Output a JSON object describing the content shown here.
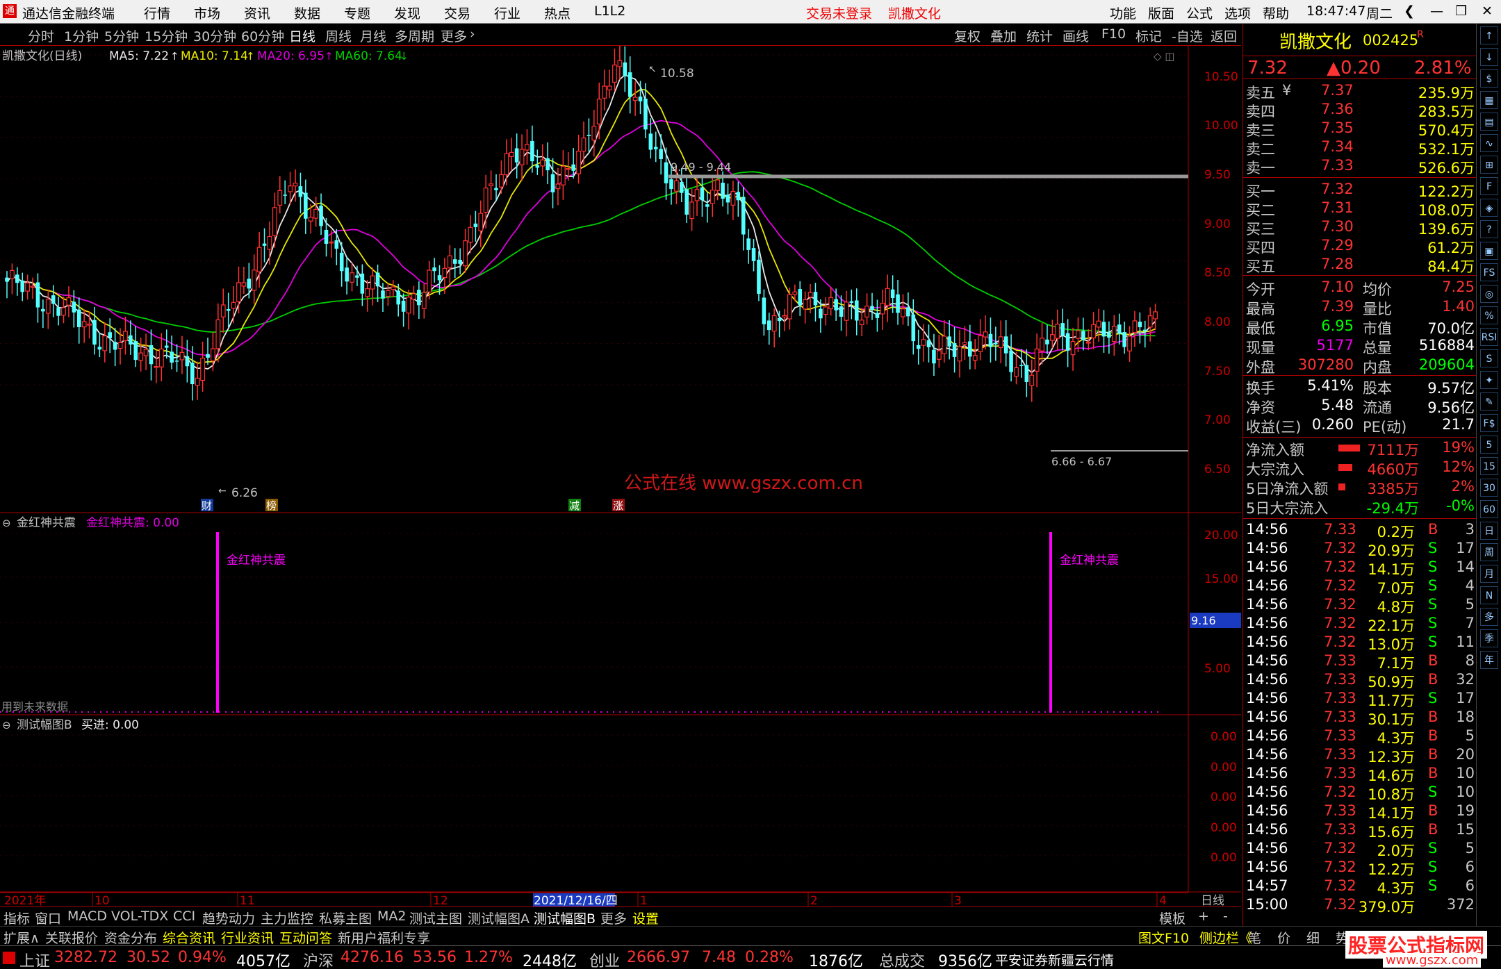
{
  "menubar": {
    "app_title": "通达信金融终端",
    "menus": [
      "行情",
      "市场",
      "资讯",
      "数据",
      "专题",
      "发现",
      "交易",
      "行业",
      "热点",
      "L1L2"
    ],
    "trade_status": "交易未登录",
    "stock_name": "凯撒文化",
    "right_menus": [
      "功能",
      "版面",
      "公式",
      "选项",
      "帮助"
    ],
    "time": "18:47:47",
    "weekday": "周二"
  },
  "periodbar": {
    "periods": [
      "分时",
      "1分钟",
      "5分钟",
      "15分钟",
      "30分钟",
      "60分钟",
      "日线",
      "周线",
      "月线",
      "多周期",
      "更多"
    ],
    "active": "日线",
    "tools": [
      "复权",
      "叠加",
      "统计",
      "画线",
      "F10",
      "标记",
      "-自选",
      "返回"
    ]
  },
  "main_chart": {
    "title": "凯撒文化(日线)",
    "ma5_label": "MA5: 7.22",
    "ma10_label": "MA10: 7.14",
    "ma20_label": "MA20: 6.95",
    "ma60_label": "MA60: 7.64",
    "y_ticks": [
      "10.50",
      "10.00",
      "9.50",
      "9.00",
      "8.50",
      "8.00",
      "7.50",
      "7.00",
      "6.50"
    ],
    "high_label": "10.58",
    "low_label": "6.26",
    "range1": "9.49 - 9.44",
    "range2": "6.66 - 6.67",
    "watermark": "公式在线 www.gszx.com.cn",
    "markers": [
      "财",
      "榜",
      "减",
      "涨"
    ]
  },
  "indicator1": {
    "name": "金红神共震",
    "value_label": "金红神共震: 0.00",
    "signal_label": "金红神共震",
    "y_ticks": [
      "20.00",
      "15.00",
      "5.00"
    ],
    "current": "9.16",
    "future_note": "用到未来数据"
  },
  "indicator2": {
    "name": "测试幅图B",
    "value_label": "买进: 0.00",
    "y_ticks": [
      "0.00",
      "0.00",
      "0.00",
      "0.00",
      "0.00"
    ]
  },
  "xaxis": {
    "labels": [
      "2021年",
      "10",
      "11",
      "12",
      "2021/12/16/四",
      "1",
      "2",
      "3",
      "4"
    ],
    "period": "日线"
  },
  "quote": {
    "name": "凯撒文化",
    "code": "002425",
    "flag": "R",
    "price": "7.32",
    "change": "▲0.20",
    "pct": "2.81%",
    "asks": [
      {
        "l": "卖五",
        "f": "¥",
        "p": "7.37",
        "v": "235.9万"
      },
      {
        "l": "卖四",
        "p": "7.36",
        "v": "283.5万"
      },
      {
        "l": "卖三",
        "p": "7.35",
        "v": "570.4万"
      },
      {
        "l": "卖二",
        "p": "7.34",
        "v": "532.1万"
      },
      {
        "l": "卖一",
        "p": "7.33",
        "v": "526.6万"
      }
    ],
    "bids": [
      {
        "l": "买一",
        "p": "7.32",
        "v": "122.2万"
      },
      {
        "l": "买二",
        "p": "7.31",
        "v": "108.0万"
      },
      {
        "l": "买三",
        "p": "7.30",
        "v": "139.6万"
      },
      {
        "l": "买四",
        "p": "7.29",
        "v": "61.2万"
      },
      {
        "l": "买五",
        "p": "7.28",
        "v": "84.4万"
      }
    ],
    "stats": [
      [
        "今开",
        "7.10",
        "均价",
        "7.25"
      ],
      [
        "最高",
        "7.39",
        "量比",
        "1.40"
      ],
      [
        "最低",
        "6.95",
        "市值",
        "70.0亿"
      ],
      [
        "现量",
        "5177",
        "总量",
        "516884"
      ],
      [
        "外盘",
        "307280",
        "内盘",
        "209604"
      ]
    ],
    "stats2": [
      [
        "换手",
        "5.41%",
        "股本",
        "9.57亿"
      ],
      [
        "净资",
        "5.48",
        "流通",
        "9.56亿"
      ],
      [
        "收益(三)",
        "0.260",
        "PE(动)",
        "21.7"
      ]
    ],
    "flows": [
      [
        "净流入额",
        "7111万",
        "19%"
      ],
      [
        "大宗流入",
        "4660万",
        "12%"
      ],
      [
        "5日净流入额",
        "3385万",
        "2%"
      ],
      [
        "5日大宗流入",
        "-29.4万",
        "-0%"
      ]
    ],
    "ticks": [
      [
        "14:56",
        "7.33",
        "0.2万",
        "B",
        "3"
      ],
      [
        "14:56",
        "7.32",
        "20.9万",
        "S",
        "17"
      ],
      [
        "14:56",
        "7.32",
        "14.1万",
        "S",
        "14"
      ],
      [
        "14:56",
        "7.32",
        "7.0万",
        "S",
        "4"
      ],
      [
        "14:56",
        "7.32",
        "4.8万",
        "S",
        "5"
      ],
      [
        "14:56",
        "7.32",
        "22.1万",
        "S",
        "7"
      ],
      [
        "14:56",
        "7.32",
        "13.0万",
        "S",
        "11"
      ],
      [
        "14:56",
        "7.33",
        "7.1万",
        "B",
        "8"
      ],
      [
        "14:56",
        "7.33",
        "50.9万",
        "B",
        "32"
      ],
      [
        "14:56",
        "7.33",
        "11.7万",
        "S",
        "17"
      ],
      [
        "14:56",
        "7.33",
        "30.1万",
        "B",
        "18"
      ],
      [
        "14:56",
        "7.33",
        "4.3万",
        "B",
        "5"
      ],
      [
        "14:56",
        "7.33",
        "12.3万",
        "B",
        "20"
      ],
      [
        "14:56",
        "7.33",
        "14.6万",
        "B",
        "10"
      ],
      [
        "14:56",
        "7.32",
        "10.8万",
        "S",
        "10"
      ],
      [
        "14:56",
        "7.33",
        "14.1万",
        "B",
        "19"
      ],
      [
        "14:56",
        "7.33",
        "15.6万",
        "B",
        "15"
      ],
      [
        "14:56",
        "7.32",
        "2.0万",
        "S",
        "5"
      ],
      [
        "14:56",
        "7.32",
        "12.2万",
        "S",
        "6"
      ],
      [
        "14:57",
        "7.32",
        "4.3万",
        "S",
        "6"
      ],
      [
        "15:00",
        "7.32",
        "379.0万",
        "",
        "372"
      ]
    ]
  },
  "iconbar": [
    "↑",
    "↓",
    "$",
    "▦",
    "▤",
    "∿",
    "⊞",
    "F",
    "◈",
    "?",
    "▣",
    "FS",
    "◎",
    "%",
    "RSI",
    "S",
    "✦",
    "✎",
    "F$",
    "5",
    "15",
    "30",
    "60",
    "日",
    "周",
    "月",
    "N",
    "多",
    "季",
    "年"
  ],
  "bottomtabs": [
    "指标",
    "窗口",
    "MACD",
    "VOL-TDX",
    "CCI",
    "趋势动力",
    "主力监控",
    "私募主图",
    "MA2",
    "测试主图",
    "测试幅图A",
    "测试幅图B",
    "更多",
    "设置",
    "模板",
    "+",
    "-"
  ],
  "extbar": [
    "扩展∧",
    "关联报价",
    "资金分布",
    "综合资讯",
    "行业资讯",
    "互动问答",
    "新用户福利专享"
  ],
  "extbar_right": [
    "图文F10",
    "侧边栏《",
    "笔",
    "价",
    "细",
    "势"
  ],
  "statusbar": {
    "items": [
      [
        "上证",
        "3282.72",
        "30.52",
        "0.94%",
        "4057亿"
      ],
      [
        "沪深",
        "4276.16",
        "53.56",
        "1.27%",
        "2448亿"
      ],
      [
        "创业",
        "2666.97",
        "7.48",
        "0.28%",
        "1876亿"
      ]
    ],
    "total_label": "总成交",
    "total": "9356亿",
    "broker": "平安证券新疆云行情",
    "watermark": "股票公式指标网",
    "watermark_url": "www.gszx.com"
  },
  "chart_data": {
    "type": "candlestick",
    "series": [
      {
        "name": "MA5"
      },
      {
        "name": "MA10"
      },
      {
        "name": "MA20"
      },
      {
        "name": "MA60"
      }
    ],
    "ylim": [
      6.2,
      10.7
    ],
    "high": 10.58,
    "low": 6.26,
    "last": 7.32
  }
}
